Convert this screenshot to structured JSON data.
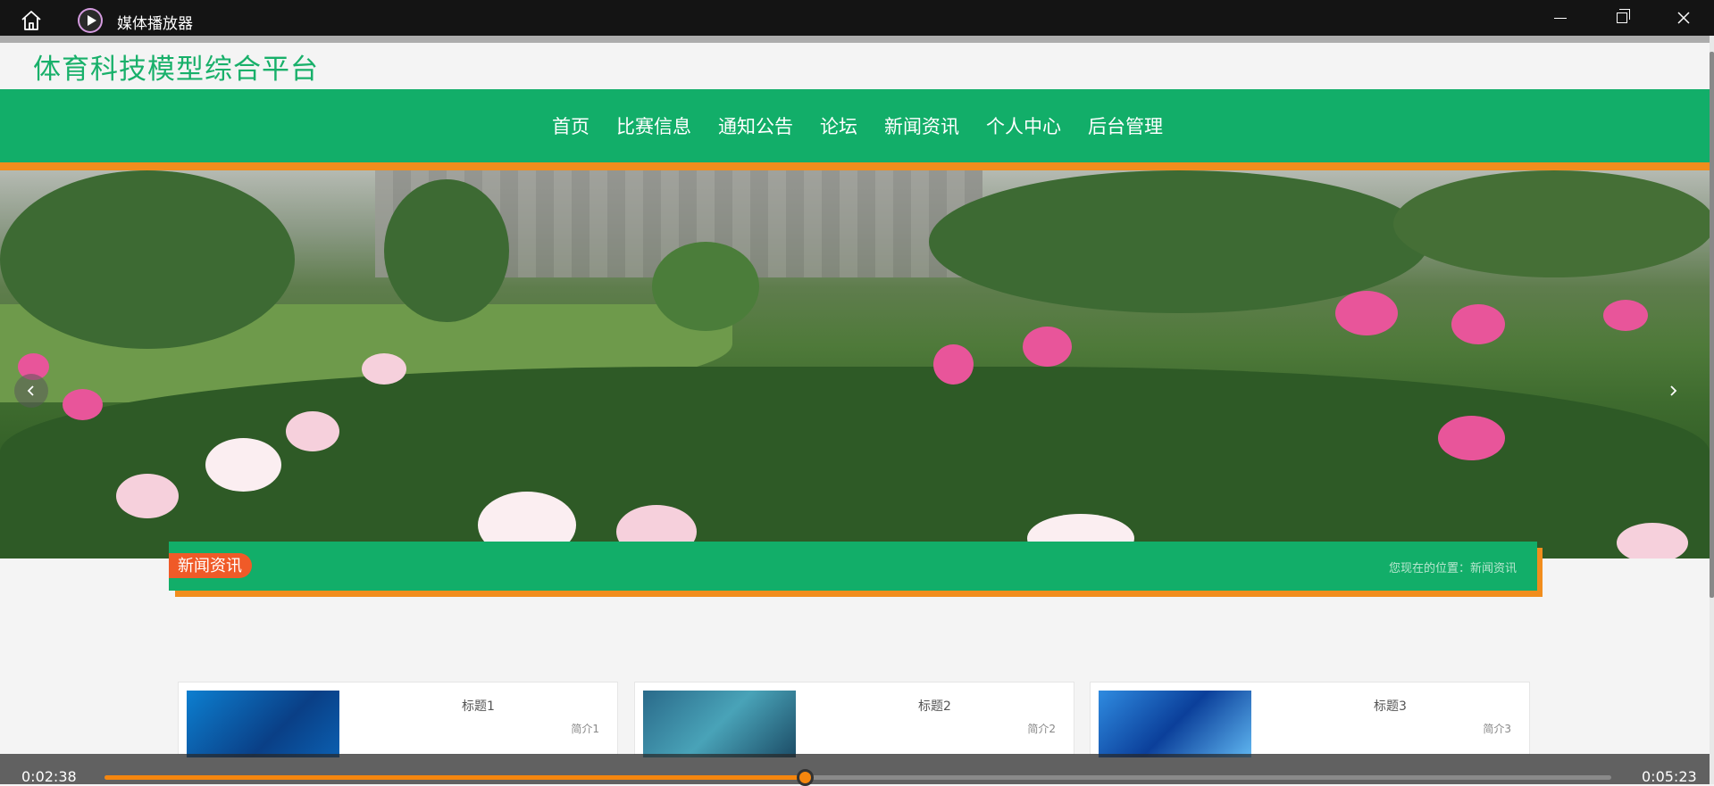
{
  "player": {
    "title": "媒体播放器",
    "current_time": "0:02:38",
    "total_time": "0:05:23",
    "progress": 0.465
  },
  "site": {
    "title": "体育科技模型综合平台"
  },
  "nav": {
    "items": [
      "首页",
      "比赛信息",
      "通知公告",
      "论坛",
      "新闻资讯",
      "个人中心",
      "后台管理"
    ]
  },
  "banner": {
    "slide_count": 3,
    "active_slide": 1
  },
  "section": {
    "title": "新闻资讯",
    "breadcrumb": "您现在的位置：新闻资讯"
  },
  "cards": [
    {
      "title": "标题1",
      "desc": "简介1"
    },
    {
      "title": "标题2",
      "desc": "简介2"
    },
    {
      "title": "标题3",
      "desc": "简介3"
    }
  ],
  "colors": {
    "brand_green": "#12ae69",
    "accent_orange": "#f18d1d",
    "badge_red": "#f05a28",
    "player_bar": "#141414"
  },
  "icons": {
    "home": "home-icon",
    "app_logo": "play-icon",
    "minimize": "minimize-icon",
    "maximize": "maximize-icon",
    "close": "close-icon",
    "prev": "chevron-left-icon",
    "next": "chevron-right-icon"
  }
}
